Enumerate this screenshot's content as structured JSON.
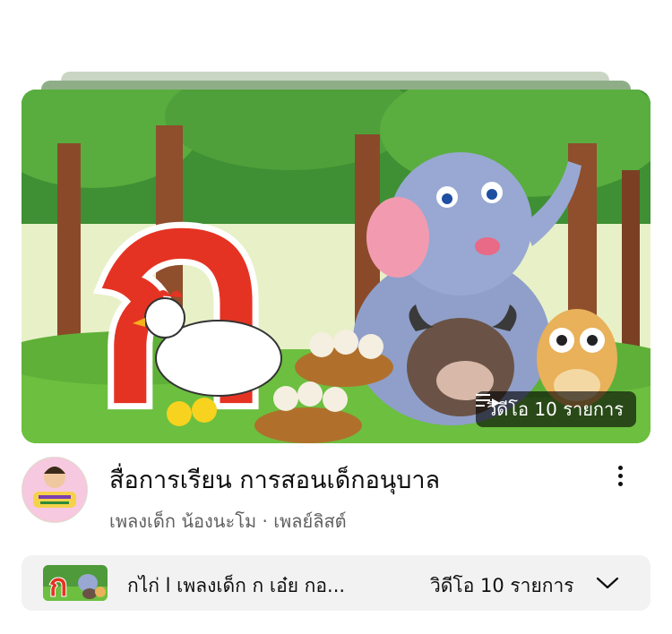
{
  "playlist": {
    "thumbnail_letter": "ก",
    "video_count_overlay": "วิดีโอ 10 รายการ",
    "title": "สื่อการเรียน การสอนเด็กอนุบาล",
    "channel": "เพลงเด็ก น้องนะโม",
    "separator": "·",
    "type": "เพลย์ลิสต์"
  },
  "now_playing": {
    "video_title": "กไก่ l เพลงเด็ก ก เอ๋ย กอ...",
    "video_count": "วิดีโอ 10 รายการ"
  },
  "icons": {
    "overlay": "playlist-icon",
    "menu": "more-vert-icon",
    "expand": "chevron-down-icon"
  },
  "colors": {
    "letter_red": "#e53323",
    "forest_green": "#4f9a3a",
    "secondary_text": "#606060"
  }
}
